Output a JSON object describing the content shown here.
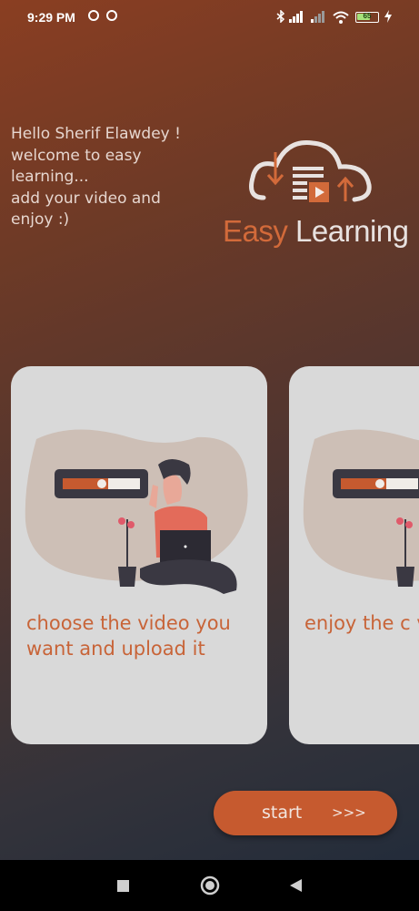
{
  "status_bar": {
    "time": "9:29 PM",
    "icons": [
      "notification-icon",
      "vpn-icon",
      "bluetooth-icon",
      "signal-icon",
      "signal-weak-icon",
      "wifi-icon",
      "battery-icon",
      "charging-icon"
    ],
    "battery_level": "65",
    "battery_fraction": 0.65
  },
  "greeting": {
    "text": "Hello Sherif Elawdey !\nwelcome to easy\nlearning...\nadd your video and\nenjoy :)"
  },
  "logo": {
    "word1": "Easy",
    "word2": "Learning",
    "accent_color": "#d26a3a"
  },
  "cards": [
    {
      "caption": "choose the video you want and upload it",
      "illustration": "person-with-laptop-upload"
    },
    {
      "caption": "enjoy the c video",
      "illustration": "person-with-laptop-upload"
    }
  ],
  "start_button": {
    "label": "start",
    "arrows": ">>>",
    "color": "#c65a2f"
  },
  "nav_bar": {
    "buttons": [
      "recents-square-icon",
      "home-circle-icon",
      "back-triangle-icon"
    ]
  }
}
